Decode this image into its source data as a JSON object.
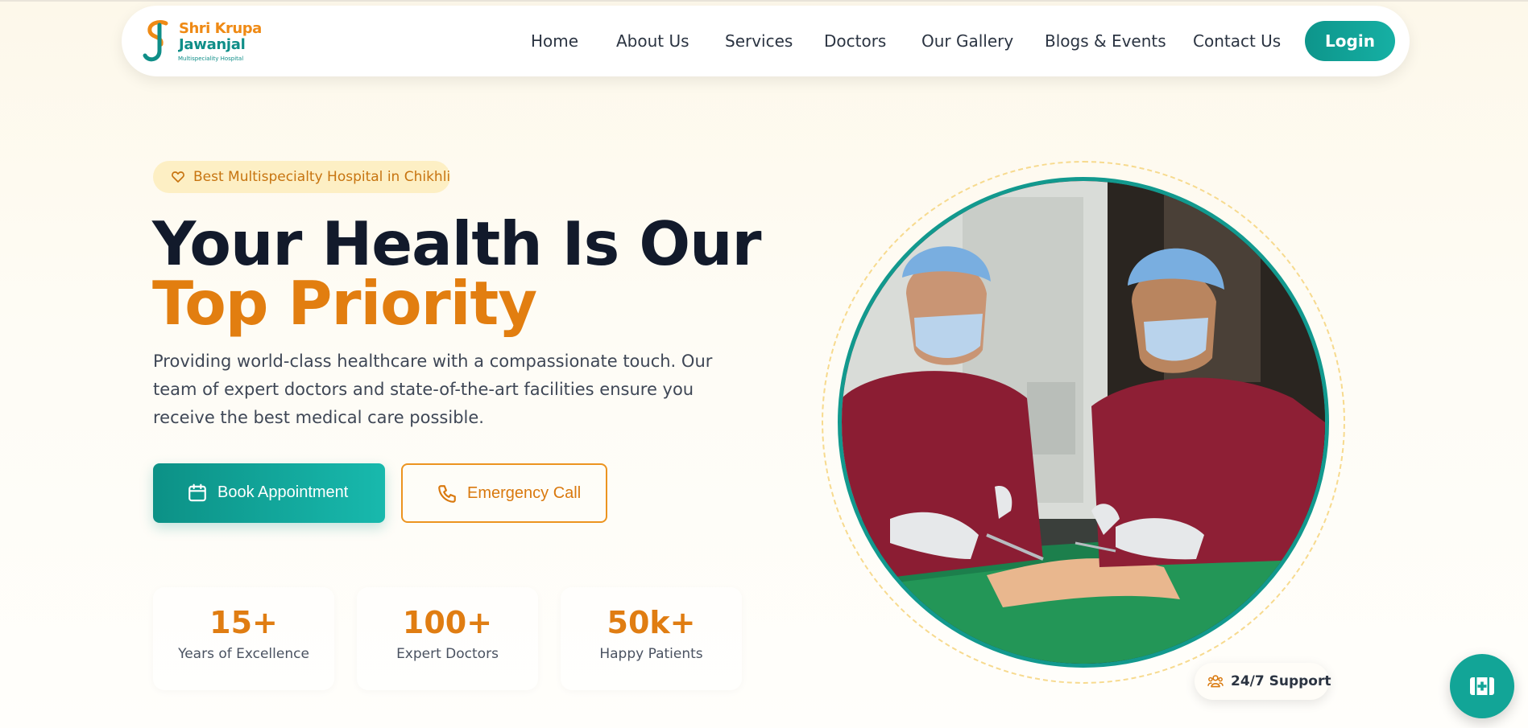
{
  "header": {
    "logo": {
      "line1": "Shri Krupa",
      "line2": "Jawanjal",
      "tagline": "Multispeciality Hospital"
    },
    "nav": [
      "Home",
      "About Us",
      "Services",
      "Doctors",
      "Our Gallery",
      "Blogs & Events",
      "Contact Us"
    ],
    "login_label": "Login"
  },
  "hero": {
    "badge": {
      "icon": "heart-icon",
      "text": "Best Multispecialty Hospital in Chikhli"
    },
    "title_line1": "Your Health Is Our",
    "title_line2": "Top Priority",
    "description": "Providing world-class healthcare with a compassionate touch. Our team of expert doctors and state-of-the-art facilities ensure you receive the best medical care possible.",
    "book_button": {
      "icon": "calendar-icon",
      "label": "Book Appointment"
    },
    "emergency_button": {
      "icon": "phone-icon",
      "label": "Emergency Call"
    },
    "stats": [
      {
        "value": "15+",
        "label": "Years of Excellence"
      },
      {
        "value": "100+",
        "label": "Expert Doctors"
      },
      {
        "value": "50k+",
        "label": "Happy Patients"
      }
    ],
    "image": {
      "description": "surgeons-operating-photo"
    },
    "support_badge": {
      "icon": "users-icon",
      "text": "24/7 Support"
    }
  },
  "floating": {
    "icon": "medical-kit-icon"
  },
  "colors": {
    "teal": "#12998e",
    "orange": "#e27e10",
    "dark": "#121a2b",
    "badge_bg": "#fdefc4"
  }
}
